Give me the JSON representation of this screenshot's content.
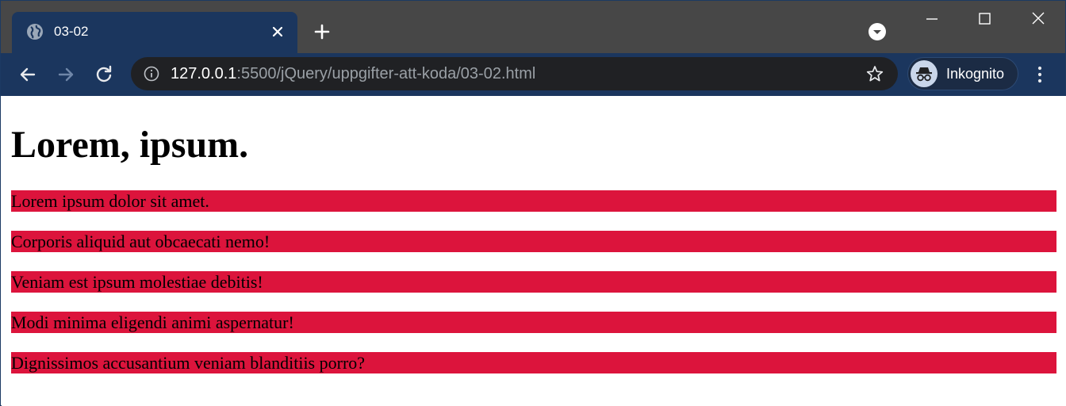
{
  "browser": {
    "tab": {
      "title": "03-02",
      "favicon": "globe-icon"
    },
    "address": {
      "host": "127.0.0.1",
      "path": ":5500/jQuery/uppgifter-att-koda/03-02.html"
    },
    "profile": {
      "label": "Inkognito",
      "icon": "incognito-icon"
    },
    "colors": {
      "frame": "#474747",
      "active_tab": "#1b365e",
      "toolbar": "#1b365e",
      "omnibox": "#202124"
    }
  },
  "page": {
    "heading": "Lorem, ipsum.",
    "paragraph_background": "#dc143c",
    "paragraphs": [
      "Lorem ipsum dolor sit amet.",
      "Corporis aliquid aut obcaecati nemo!",
      "Veniam est ipsum molestiae debitis!",
      "Modi minima eligendi animi aspernatur!",
      "Dignissimos accusantium veniam blanditiis porro?"
    ]
  }
}
